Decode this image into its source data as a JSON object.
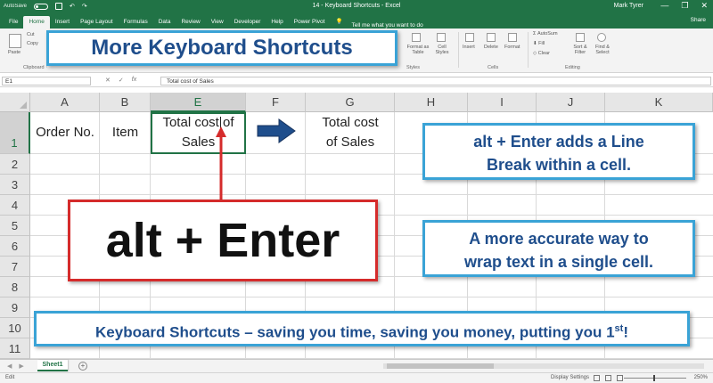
{
  "window": {
    "autosave_label": "AutoSave",
    "autosave_state": "Off",
    "title": "14 - Keyboard Shortcuts  -  Excel",
    "user": "Mark Tyrer",
    "min": "—",
    "restore": "❐",
    "close": "✕",
    "share": "Share"
  },
  "tabs": [
    "File",
    "Home",
    "Insert",
    "Page Layout",
    "Formulas",
    "Data",
    "Review",
    "View",
    "Developer",
    "Help",
    "Power Pivot"
  ],
  "active_tab": "Home",
  "tell_me": "Tell me what you want to do",
  "ribbon": {
    "paste": "Paste",
    "cut": "Cut",
    "copy": "Copy",
    "clipboard": "Clipboard",
    "format_as_table": "Format as Table",
    "cell_styles": "Cell Styles",
    "styles": "Styles",
    "insert": "Insert",
    "delete": "Delete",
    "format": "Format",
    "cells": "Cells",
    "autosum": "AutoSum",
    "fill": "Fill",
    "clear": "Clear",
    "sort_filter": "Sort & Filter",
    "find_select": "Find & Select",
    "editing": "Editing"
  },
  "formula_bar": {
    "name_box": "E1",
    "cancel": "✕",
    "enter": "✓",
    "fx": "fx",
    "content": "Total cost of Sales"
  },
  "columns": [
    "A",
    "B",
    "E",
    "F",
    "G",
    "H",
    "I",
    "J",
    "K"
  ],
  "rows": [
    "1",
    "2",
    "3",
    "4",
    "5",
    "6",
    "7",
    "8",
    "9",
    "10",
    "11"
  ],
  "cells": {
    "a1": "Order No.",
    "b1": "Item",
    "e1_line1": "Total cost of",
    "e1_line2": "Sales",
    "g1_line1": "Total cost",
    "g1_line2": "of Sales"
  },
  "overlays": {
    "title": "More Keyboard Shortcuts",
    "shortcut": "alt + Enter",
    "tip1_line1": "alt + Enter adds a Line",
    "tip1_line2": "Break within a cell.",
    "tip2_line1": "A more accurate way to",
    "tip2_line2": "wrap text in a single cell.",
    "footer": "Keyboard Shortcuts – saving you time, saving you money, putting you 1",
    "footer_sup": "st",
    "footer_end": "!"
  },
  "sheet": {
    "tab": "Sheet1",
    "add": "+",
    "nav_prev": "◀",
    "nav_next": "▶"
  },
  "status": {
    "mode": "Edit",
    "display_settings": "Display Settings",
    "zoom": "250%"
  },
  "colors": {
    "excel_green": "#217346",
    "callout_blue_border": "#3aa3d6",
    "callout_blue_text": "#1f4e8c",
    "callout_red_border": "#d52b2b",
    "arrow_blue": "#1f4e8c",
    "arrow_red": "#d52b2b"
  }
}
